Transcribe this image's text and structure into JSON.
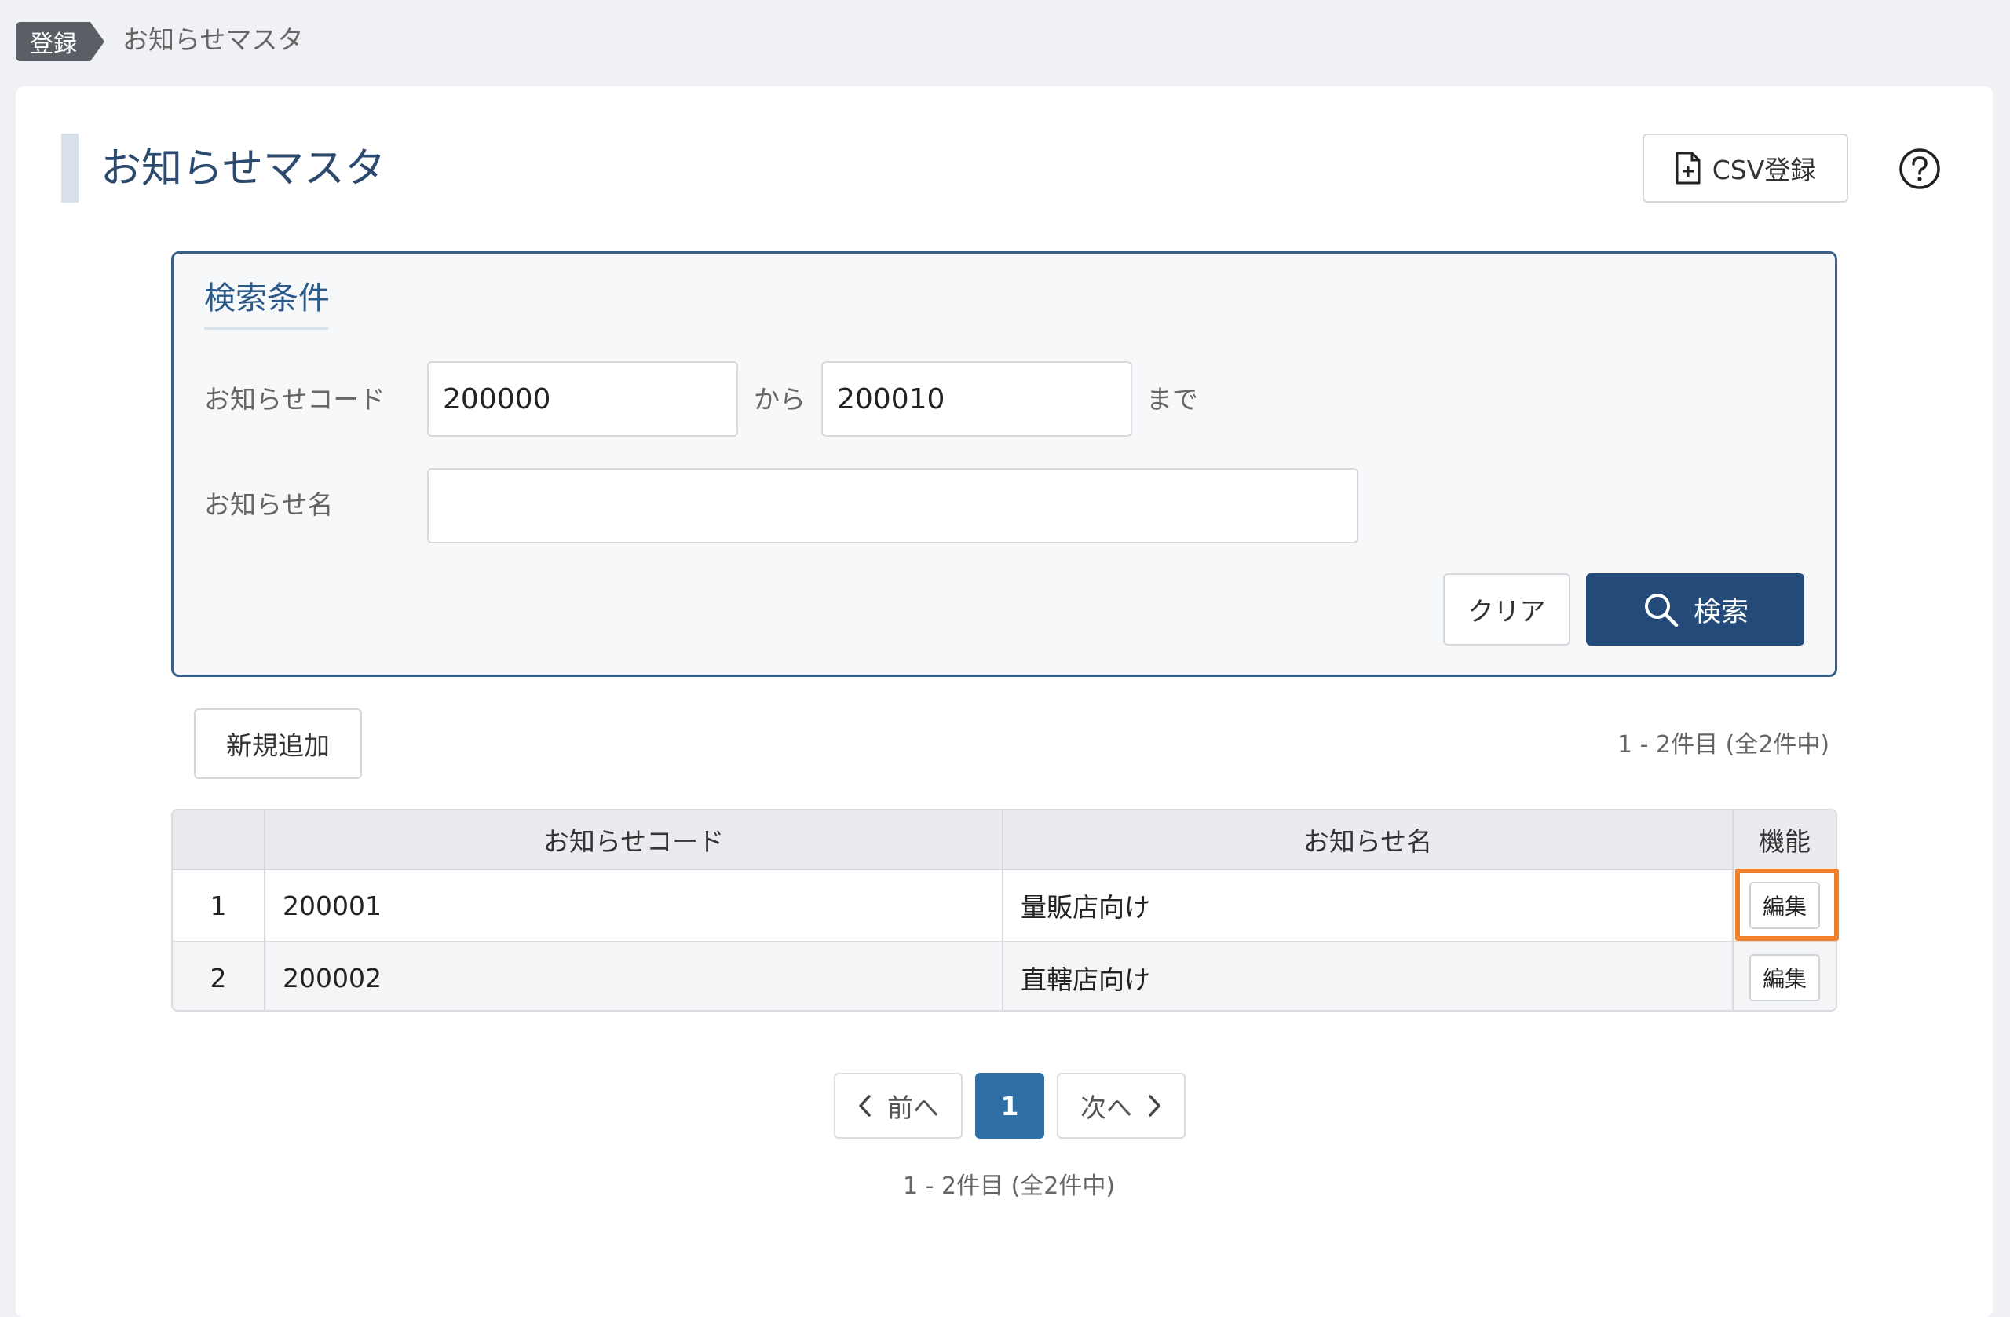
{
  "breadcrumb": {
    "badge": "登録",
    "current": "お知らせマスタ"
  },
  "page": {
    "title": "お知らせマスタ",
    "csv_button": "CSV登録",
    "help_icon": "question-circle-icon"
  },
  "search": {
    "heading": "検索条件",
    "code_label": "お知らせコード",
    "code_from": "200000",
    "range_from_text": "から",
    "code_to": "200010",
    "range_to_text": "まで",
    "name_label": "お知らせ名",
    "name_value": "",
    "clear_button": "クリア",
    "search_button": "検索"
  },
  "list": {
    "add_button": "新規追加",
    "count_text": "1 - 2件目 (全2件中)",
    "columns": [
      "",
      "お知らせコード",
      "お知らせ名",
      "機能"
    ],
    "rows": [
      {
        "no": "1",
        "code": "200001",
        "name": "量販店向け",
        "action": "編集"
      },
      {
        "no": "2",
        "code": "200002",
        "name": "直轄店向け",
        "action": "編集"
      }
    ]
  },
  "pagination": {
    "prev": "前へ",
    "current_page": "1",
    "next": "次へ",
    "count_text": "1 - 2件目 (全2件中)"
  },
  "colors": {
    "accent": "#234a78",
    "highlight": "#ee7f2d",
    "page_active": "#2f6fa5"
  }
}
